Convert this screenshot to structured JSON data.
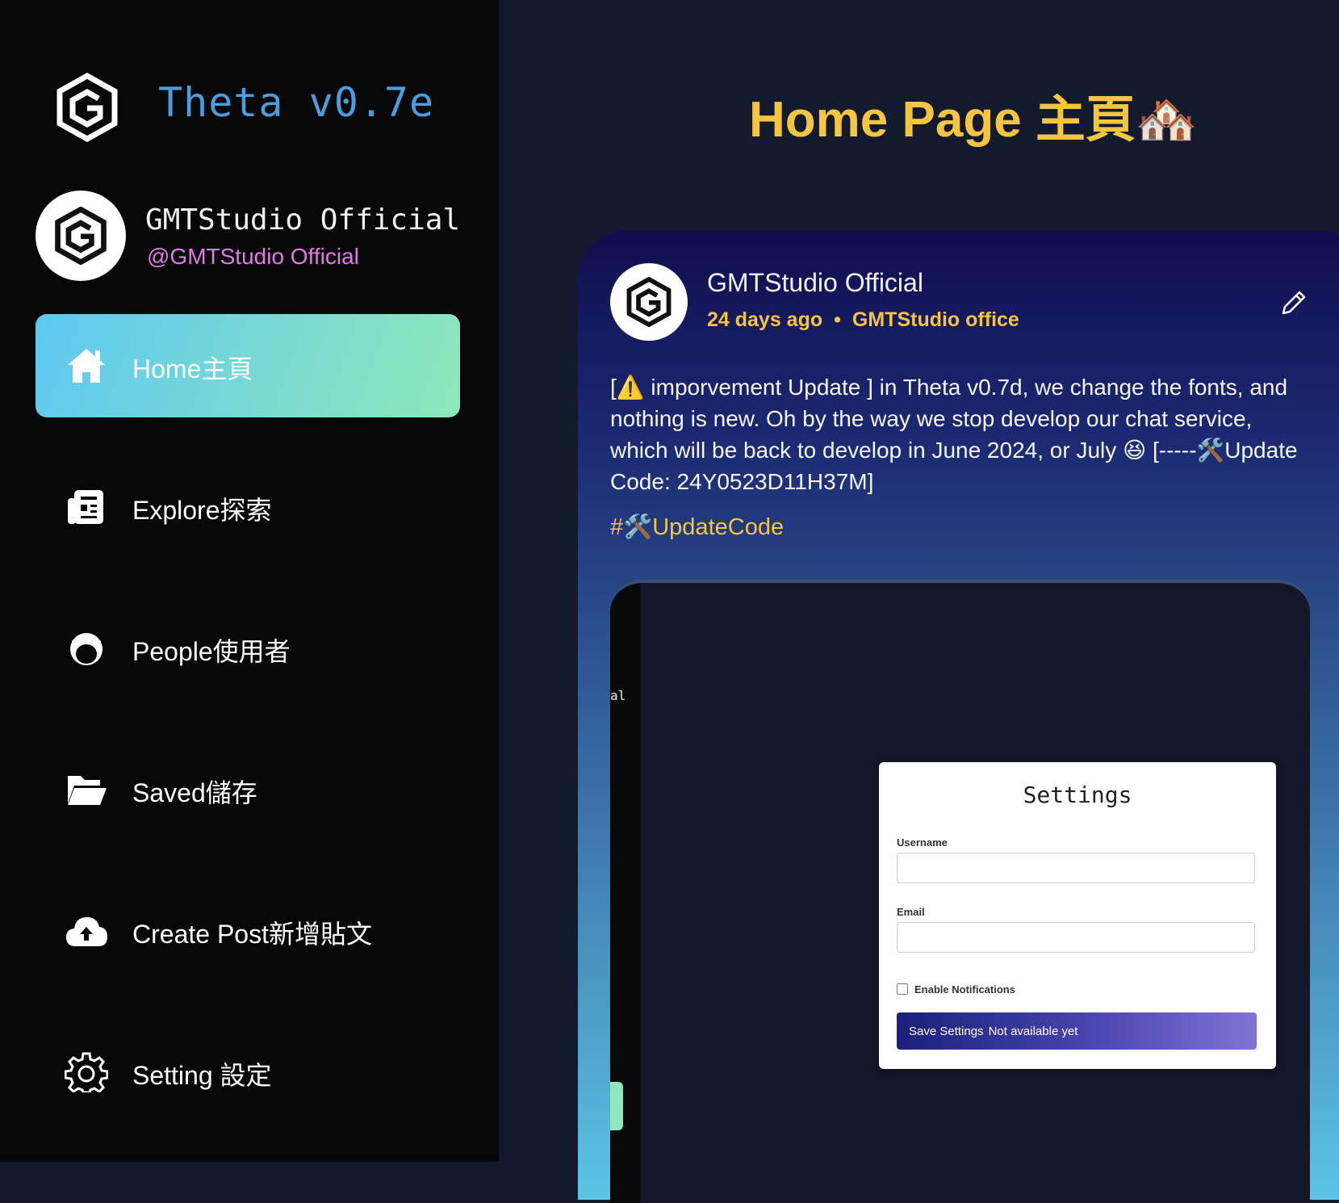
{
  "app": {
    "title": "Theta v0.7e"
  },
  "profile": {
    "name": "GMTStudio Official",
    "handle": "@GMTStudio Official"
  },
  "nav": {
    "items": [
      {
        "label": "Home主頁",
        "icon": "home-icon",
        "active": true
      },
      {
        "label": "Explore探索",
        "icon": "newspaper-icon",
        "active": false
      },
      {
        "label": "People使用者",
        "icon": "user-face-icon",
        "active": false
      },
      {
        "label": "Saved儲存",
        "icon": "folder-open-icon",
        "active": false
      },
      {
        "label": "Create Post新增貼文",
        "icon": "cloud-upload-icon",
        "active": false
      },
      {
        "label": "Setting 設定",
        "icon": "gear-icon",
        "active": false
      }
    ]
  },
  "main": {
    "title": "Home Page 主頁🏘️"
  },
  "post": {
    "author": "GMTStudio Official",
    "time": "24 days ago",
    "separator": "•",
    "location": "GMTStudio office",
    "body": "[⚠️ imporvement Update ] in Theta v0.7d, we change the fonts, and nothing is new. Oh by the way we stop develop our chat service, which will be back to develop in June 2024, or July 😆 [-----🛠️Update Code: 24Y0523D11H37M]",
    "tag": "#🛠️UpdateCode"
  },
  "embed": {
    "strip_text": "al",
    "settings": {
      "title": "Settings",
      "username_label": "Username",
      "username_value": "",
      "email_label": "Email",
      "email_value": "",
      "notifications_label": "Enable Notifications",
      "notifications_checked": false,
      "save_label": "Save Settings",
      "save_note": "Not available yet"
    }
  },
  "colors": {
    "accent_yellow": "#f5c542",
    "title_blue": "#4a9ee0",
    "handle_pink": "#e07ae8",
    "active_gradient_start": "#5ec8f2",
    "active_gradient_end": "#8fe8b9"
  }
}
